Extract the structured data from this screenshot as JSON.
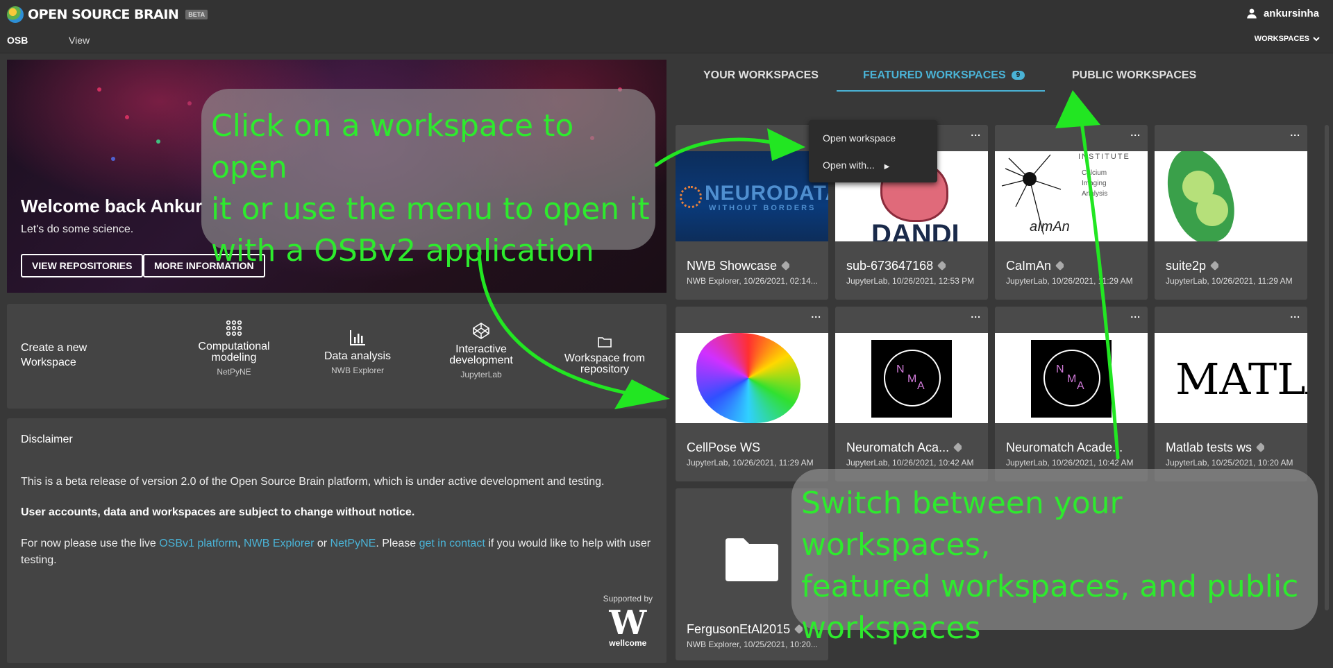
{
  "app": {
    "brand_name": "OPEN SOURCE BRAIN",
    "beta_label": "BETA",
    "username": "ankursinha",
    "menu_osb": "OSB",
    "menu_view": "View",
    "workspaces_menu": "WORKSPACES"
  },
  "hero": {
    "title": "Welcome back Ankur",
    "subtitle": "Let's do some science.",
    "btn_repos": "VIEW REPOSITORIES",
    "btn_info": "MORE INFORMATION"
  },
  "create": {
    "label": "Create a new Workspace",
    "options": [
      {
        "title": "Computational modeling",
        "sub": "NetPyNE",
        "icon": "grid-dots-icon"
      },
      {
        "title": "Data analysis",
        "sub": "NWB Explorer",
        "icon": "bar-chart-icon"
      },
      {
        "title": "Interactive development",
        "sub": "JupyterLab",
        "icon": "codepen-icon"
      },
      {
        "title": "Workspace from repository",
        "sub": "",
        "icon": "folder-icon"
      }
    ]
  },
  "disclaimer": {
    "title": "Disclaimer",
    "p1": "This is a beta release of version 2.0 of the Open Source Brain platform, which is under active development and testing.",
    "p2": "User accounts, data and workspaces are subject to change without notice.",
    "p3_a": "For now please use the live ",
    "p3_link1": "OSBv1 platform",
    "p3_b": ", ",
    "p3_link2": "NWB Explorer",
    "p3_c": " or ",
    "p3_link3": "NetPyNE",
    "p3_d": ". Please ",
    "p3_link4": "get in contact",
    "p3_e": " if you would like to help with user testing.",
    "supported_by": "Supported by",
    "sponsor_logo": "W",
    "sponsor_name": "wellcome"
  },
  "tabs": {
    "yours": "YOUR WORKSPACES",
    "featured": "FEATURED WORKSPACES",
    "featured_count": "9",
    "public": "PUBLIC WORKSPACES"
  },
  "cards": [
    {
      "title": "NWB Showcase",
      "sub": "NWB Explorer, 10/26/2021, 02:14...",
      "img_text1": "NEURODATA",
      "img_text2": "WITHOUT BORDERS"
    },
    {
      "title": "sub-673647168",
      "sub": "JupyterLab, 10/26/2021, 12:53 PM",
      "img_text1": "DANDI"
    },
    {
      "title": "CaImAn",
      "sub": "JupyterLab, 10/26/2021, 11:29 AM",
      "img_text1": "INSTITUTE",
      "img_text2": "Calcium",
      "img_text3": "Imaging",
      "img_text4": "Analysis",
      "img_text5": "aImAn"
    },
    {
      "title": "suite2p",
      "sub": "JupyterLab, 10/26/2021, 11:29 AM"
    },
    {
      "title": "CellPose WS",
      "sub": "JupyterLab, 10/26/2021, 11:29 AM"
    },
    {
      "title": "Neuromatch Aca...",
      "sub": "JupyterLab, 10/26/2021, 10:42 AM",
      "img_text1": "N",
      "img_text2": "M",
      "img_text3": "A"
    },
    {
      "title": "Neuromatch Acade...",
      "sub": "JupyterLab, 10/26/2021, 10:42 AM",
      "img_text1": "N",
      "img_text2": "M",
      "img_text3": "A"
    },
    {
      "title": "Matlab tests ws",
      "sub": "JupyterLab, 10/25/2021, 10:20 AM",
      "img_text1": "MATLA"
    },
    {
      "title": "FergusonEtAl2015",
      "sub": "NWB Explorer, 10/25/2021, 10:20..."
    }
  ],
  "card_menu_glyph": "...",
  "dropdown": {
    "open": "Open workspace",
    "open_with": "Open with..."
  },
  "callouts": {
    "left_lines": [
      "Click on a workspace to open",
      "it or use the menu to open it",
      "with a OSBv2 application"
    ],
    "right_lines": [
      "Switch between your workspaces,",
      "featured workspaces, and public",
      "workspaces"
    ]
  },
  "colors": {
    "accent": "#4ab3d6",
    "background": "#383838",
    "panel": "#444444",
    "card": "#4a4a4a",
    "annotation": "#2eea2e"
  }
}
